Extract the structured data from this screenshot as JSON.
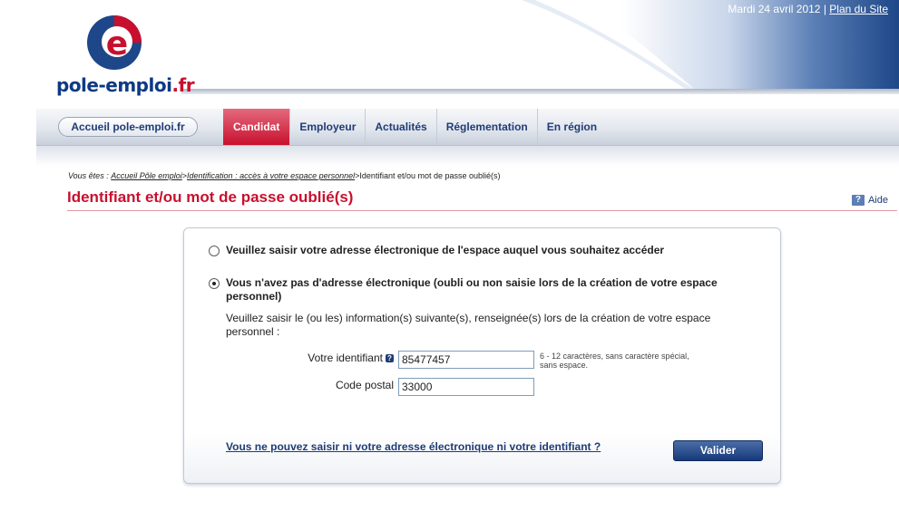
{
  "header": {
    "date": "Mardi 24 avril 2012",
    "separator": "|",
    "sitemap_link": "Plan du Site",
    "logo_text_main": "pole-emploi",
    "logo_text_tld": ".fr",
    "logo_letter": "e"
  },
  "nav": {
    "home_label": "Accueil pole-emploi.fr",
    "tabs": [
      {
        "label": "Candidat",
        "active": true
      },
      {
        "label": "Employeur"
      },
      {
        "label": "Actualités"
      },
      {
        "label": "Réglementation"
      },
      {
        "label": "En région"
      }
    ]
  },
  "breadcrumb": {
    "prefix": "Vous êtes :",
    "items": [
      "Accueil Pôle emploi",
      "Identification : accès à votre espace personnel",
      "Identifiant et/ou mot de passe oublié(s)"
    ],
    "separator": ">"
  },
  "page": {
    "title": "Identifiant et/ou mot de passe oublié(s)",
    "help_icon_glyph": "?",
    "help_label": "Aide"
  },
  "form": {
    "option1_label": "Veuillez saisir votre adresse électronique de l'espace auquel vous souhaitez accéder",
    "option2_label": "Vous n'avez pas d'adresse électronique (oubli ou non saisie lors de la création de votre espace personnel)",
    "option2_selected": true,
    "instructions": "Veuillez saisir le (ou les) information(s) suivante(s), renseignée(s) lors de la création de votre espace personnel :",
    "identifier_label": "Votre identifiant",
    "identifier_info_glyph": "?",
    "identifier_value": "85477457",
    "identifier_hint": "6 - 12 caractères, sans caractère spécial, sans espace.",
    "postal_label": "Code postal",
    "postal_value": "33000",
    "help_link": "Vous ne pouvez saisir ni votre adresse électronique ni votre identifiant ?",
    "submit_label": "Valider"
  },
  "colors": {
    "brand_blue": "#1f3c76",
    "brand_red": "#c8102e"
  }
}
